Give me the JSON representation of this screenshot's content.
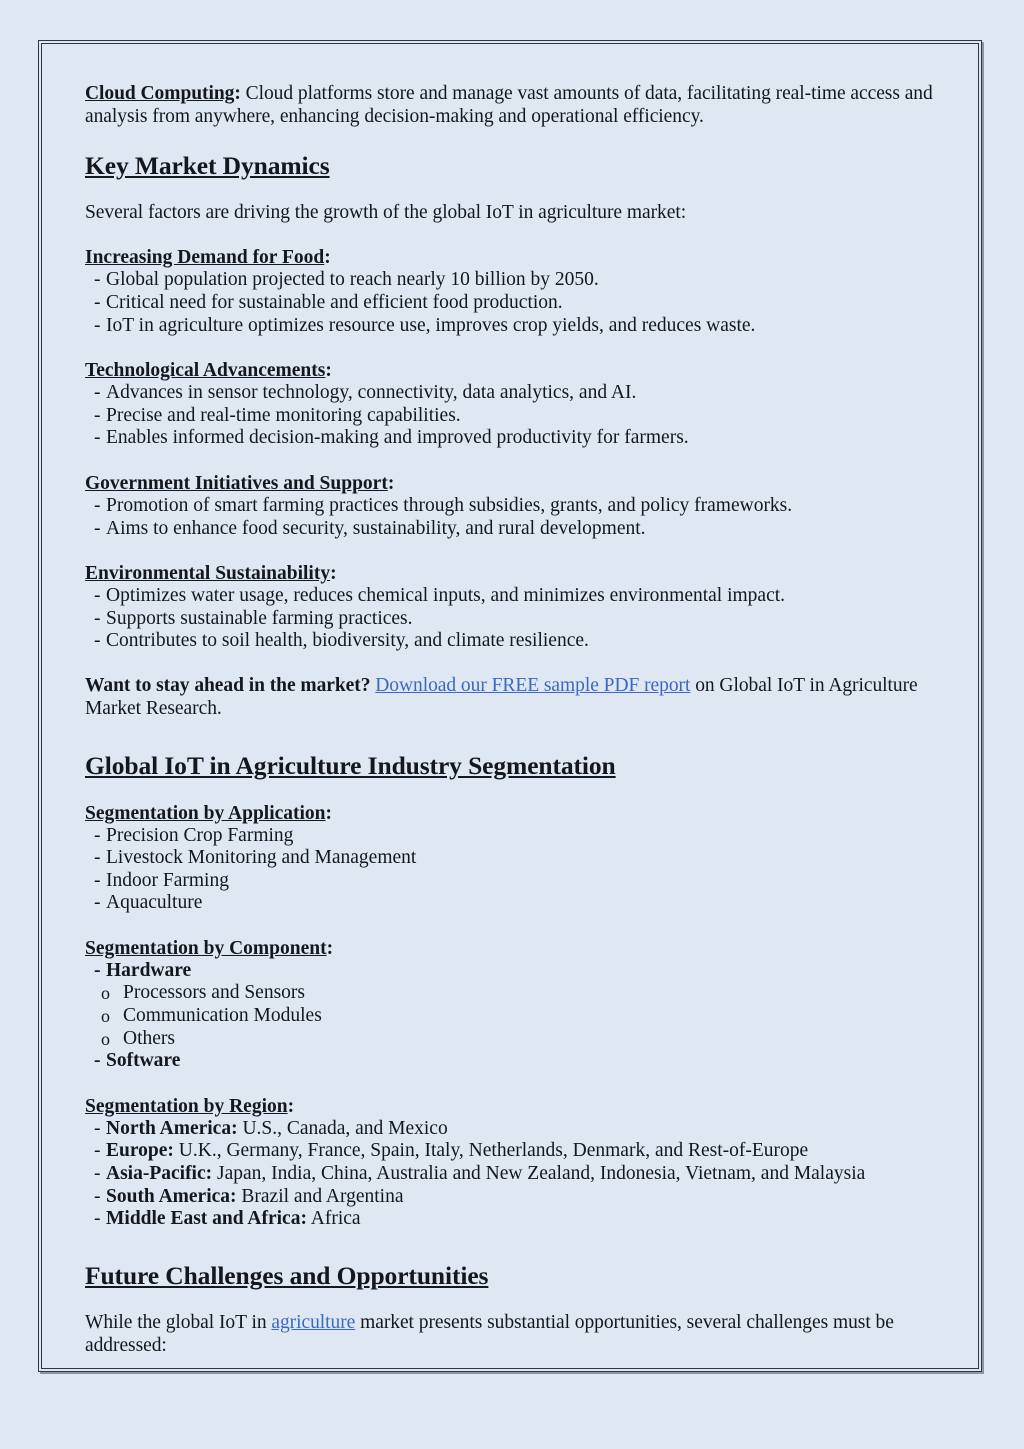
{
  "theme": {
    "page_background": "#dfe7f3",
    "border_color": "#2b3648",
    "shadow_color": "#8b96a3",
    "text_color": "#14171c",
    "link_color": "#3a69c2"
  },
  "intro_paragraph": {
    "label": "Cloud Computing",
    "colon": ":",
    "body": " Cloud platforms store and manage vast amounts of data, facilitating real-time access and analysis from anywhere, enhancing decision-making and operational efficiency."
  },
  "key_market_dynamics": {
    "heading": "Key Market Dynamics",
    "lead": "Several factors are driving the growth of the global IoT in agriculture market:",
    "groups": [
      {
        "label": "Increasing Demand for Food",
        "colon": ":",
        "items": [
          "Global population projected to reach nearly 10 billion by 2050.",
          "Critical need for sustainable and efficient food production.",
          "IoT in agriculture optimizes resource use, improves crop yields, and reduces waste."
        ]
      },
      {
        "label": "Technological Advancements",
        "colon": ":",
        "items": [
          "Advances in sensor technology, connectivity, data analytics, and AI.",
          "Precise and real-time monitoring capabilities.",
          "Enables informed decision-making and improved productivity for farmers."
        ]
      },
      {
        "label": "Government Initiatives and Support",
        "colon": ":",
        "items": [
          "Promotion of smart farming practices through subsidies, grants, and policy frameworks.",
          "Aims to enhance food security, sustainability, and rural development."
        ]
      },
      {
        "label": "Environmental Sustainability",
        "colon": ":",
        "items": [
          "Optimizes water usage, reduces chemical inputs, and minimizes environmental impact.",
          "Supports sustainable farming practices.",
          "Contributes to soil health, biodiversity, and climate resilience."
        ]
      }
    ]
  },
  "cta": {
    "lead_bold": "Want to stay ahead in the market?",
    "link_text": "Download our FREE sample PDF report",
    "tail": " on Global IoT in Agriculture Market Research."
  },
  "segmentation": {
    "heading": "Global IoT in Agriculture Industry Segmentation",
    "by_application": {
      "label": "Segmentation by Application",
      "colon": ":",
      "items": [
        "Precision Crop Farming",
        "Livestock Monitoring and Management",
        "Indoor Farming",
        "Aquaculture"
      ]
    },
    "by_component": {
      "label": "Segmentation by Component",
      "colon": ":",
      "hardware": "Hardware",
      "hardware_children": [
        "Processors and Sensors",
        "Communication Modules",
        "Others"
      ],
      "software": "Software"
    },
    "by_region": {
      "label": "Segmentation by Region",
      "colon": ":",
      "items": [
        {
          "region": "North America:",
          "detail": " U.S., Canada, and Mexico"
        },
        {
          "region": "Europe:",
          "detail": " U.K., Germany, France, Spain, Italy, Netherlands, Denmark, and Rest-of-Europe"
        },
        {
          "region": "Asia-Pacific:",
          "detail": " Japan, India, China, Australia and New Zealand, Indonesia, Vietnam, and Malaysia"
        },
        {
          "region": "South America:",
          "detail": " Brazil and Argentina"
        },
        {
          "region": "Middle East and Africa:",
          "detail": " Africa"
        }
      ]
    }
  },
  "future": {
    "heading": "Future Challenges and Opportunities",
    "text_before_link": "While the global IoT in ",
    "link_text": "agriculture",
    "text_after_link": " market presents substantial opportunities, several challenges must be addressed:"
  }
}
